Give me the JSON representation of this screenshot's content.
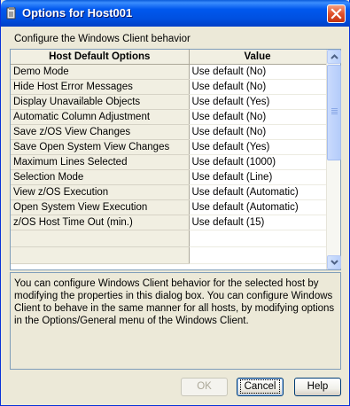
{
  "window": {
    "title": "Options for Host001",
    "icon": "document-icon",
    "close_icon": "close-icon",
    "accent_color": "#0054e3"
  },
  "caption": "Configure the Windows Client behavior",
  "table": {
    "columns": [
      "Host Default Options",
      "Value"
    ],
    "rows": [
      {
        "option": "Demo Mode",
        "value": "Use default (No)"
      },
      {
        "option": "Hide Host Error Messages",
        "value": "Use default (No)"
      },
      {
        "option": "Display Unavailable Objects",
        "value": "Use default (Yes)"
      },
      {
        "option": "Automatic Column Adjustment",
        "value": "Use default (No)"
      },
      {
        "option": "Save z/OS View Changes",
        "value": "Use default (No)"
      },
      {
        "option": "Save Open System View Changes",
        "value": "Use default (Yes)"
      },
      {
        "option": "Maximum Lines Selected",
        "value": "Use default (1000)"
      },
      {
        "option": "Selection Mode",
        "value": "Use default (Line)"
      },
      {
        "option": "View z/OS Execution",
        "value": "Use default (Automatic)"
      },
      {
        "option": "Open System View Execution",
        "value": "Use default (Automatic)"
      },
      {
        "option": "z/OS Host Time Out (min.)",
        "value": "Use default (15)"
      }
    ]
  },
  "description": "You can configure Windows Client behavior for the selected host by modifying the properties in this dialog box. You can configure Windows Client to behave in the same manner for all hosts, by modifying options in the Options/General menu of the Windows Client.",
  "buttons": {
    "ok": "OK",
    "cancel": "Cancel",
    "help": "Help"
  }
}
